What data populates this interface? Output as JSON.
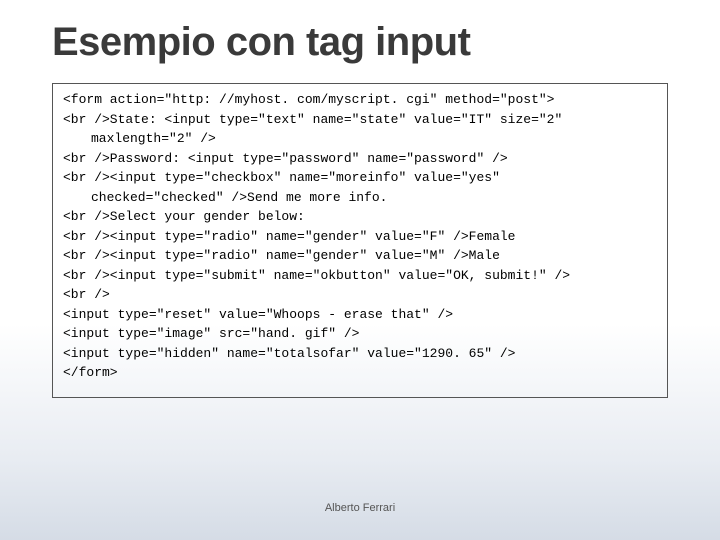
{
  "title": "Esempio con tag input",
  "code": {
    "l01": "<form action=\"http: //myhost. com/myscript. cgi\" method=\"post\">",
    "l02": "<br />State: <input type=\"text\" name=\"state\" value=\"IT\" size=\"2\"",
    "l03": "maxlength=\"2\" />",
    "l04": "<br />Password: <input type=\"password\" name=\"password\" />",
    "l05": "<br /><input type=\"checkbox\" name=\"moreinfo\" value=\"yes\"",
    "l06": "checked=\"checked\" />Send me more info.",
    "l07": "<br />Select your gender below:",
    "l08": "<br /><input type=\"radio\" name=\"gender\" value=\"F\" />Female",
    "l09": "<br /><input type=\"radio\" name=\"gender\" value=\"M\" />Male",
    "l10": "<br /><input type=\"submit\" name=\"okbutton\" value=\"OK, submit!\" />",
    "l11": "<br />",
    "l12": "<input type=\"reset\" value=\"Whoops - erase that\" />",
    "l13": "<input type=\"image\" src=\"hand. gif\" />",
    "l14": "<input type=\"hidden\" name=\"totalsofar\" value=\"1290. 65\" />",
    "l15": "</form>"
  },
  "footer": "Alberto Ferrari"
}
